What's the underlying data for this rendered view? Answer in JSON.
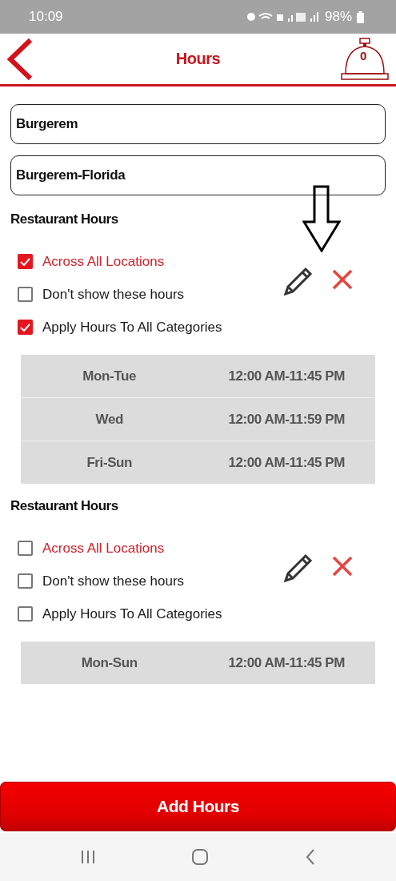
{
  "status_bar": {
    "time": "10:09",
    "battery": "98%"
  },
  "header": {
    "title": "Hours",
    "bell_count": "0"
  },
  "fields": [
    {
      "value": "Burgerem"
    },
    {
      "value": "Burgerem-Florida"
    }
  ],
  "sections": [
    {
      "title": "Restaurant Hours",
      "arrow_marker": true,
      "options": [
        {
          "kind": "accent",
          "label": "Across All Locations",
          "checked": true
        },
        {
          "kind": "plain",
          "label": "Don't show these hours",
          "checked": false
        },
        {
          "kind": "plain",
          "label": "Apply Hours To All Categories",
          "checked": true
        }
      ],
      "rows": [
        {
          "days": "Mon-Tue",
          "hours": "12:00 AM-11:45 PM"
        },
        {
          "days": "Wed",
          "hours": "12:00 AM-11:59 PM"
        },
        {
          "days": "Fri-Sun",
          "hours": "12:00 AM-11:45 PM"
        }
      ]
    },
    {
      "title": "Restaurant Hours",
      "arrow_marker": false,
      "options": [
        {
          "kind": "accent",
          "label": "Across All Locations",
          "checked": false
        },
        {
          "kind": "plain",
          "label": "Don't show these hours",
          "checked": false
        },
        {
          "kind": "plain",
          "label": "Apply Hours To All Categories",
          "checked": false
        }
      ],
      "rows": [
        {
          "days": "Mon-Sun",
          "hours": "12:00 AM-11:45 PM"
        }
      ]
    }
  ],
  "add_button": "Add Hours"
}
